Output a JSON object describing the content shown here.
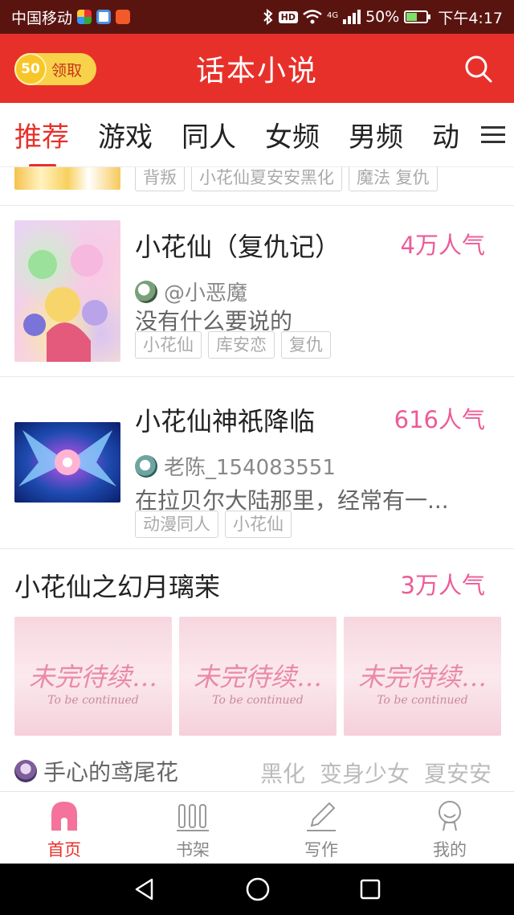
{
  "status_bar": {
    "carrier": "中国移动",
    "network_label": "4G",
    "hd_label": "HD",
    "battery": "50%",
    "time": "下午4:17",
    "battery_level": 0.5
  },
  "header": {
    "reward_count": "50",
    "reward_label": "领取",
    "title": "话本小说",
    "search_icon": "search-icon"
  },
  "tabs": {
    "items": [
      "推荐",
      "游戏",
      "同人",
      "女频",
      "男频",
      "动"
    ],
    "active_index": 0
  },
  "feed": {
    "partial_row": {
      "tags": [
        "背叛",
        "小花仙夏安安黑化",
        "魔法  复仇"
      ]
    },
    "books": [
      {
        "title": "小花仙（复仇记）",
        "popularity": "4万人气",
        "author": "@小恶魔",
        "description": "没有什么要说的",
        "tags": [
          "小花仙",
          "库安恋",
          "复仇"
        ]
      },
      {
        "title": "小花仙神祇降临",
        "popularity": "616人气",
        "author": "老陈_154083551",
        "description": "在拉贝尔大陆那里，经常有一...",
        "tags": [
          "动漫同人",
          "小花仙"
        ]
      }
    ],
    "card": {
      "title": "小花仙之幻月璃茉",
      "popularity": "3万人气",
      "thumbnails": [
        {
          "text": "未完待续…",
          "subtext": "To be continued"
        },
        {
          "text": "未完待续…",
          "subtext": "To be continued"
        },
        {
          "text": "未完待续…",
          "subtext": "To be continued"
        }
      ],
      "author": "手心的鸢尾花",
      "tags": [
        "黑化",
        "变身少女",
        "夏安安"
      ]
    }
  },
  "bottom_nav": {
    "items": [
      {
        "label": "首页",
        "icon": "home-icon"
      },
      {
        "label": "书架",
        "icon": "bookshelf-icon"
      },
      {
        "label": "写作",
        "icon": "pencil-icon"
      },
      {
        "label": "我的",
        "icon": "profile-icon"
      }
    ],
    "active_index": 0
  },
  "colors": {
    "brand": "#e8302a",
    "popularity": "#ec5b97",
    "status_bar": "#5a1410"
  }
}
